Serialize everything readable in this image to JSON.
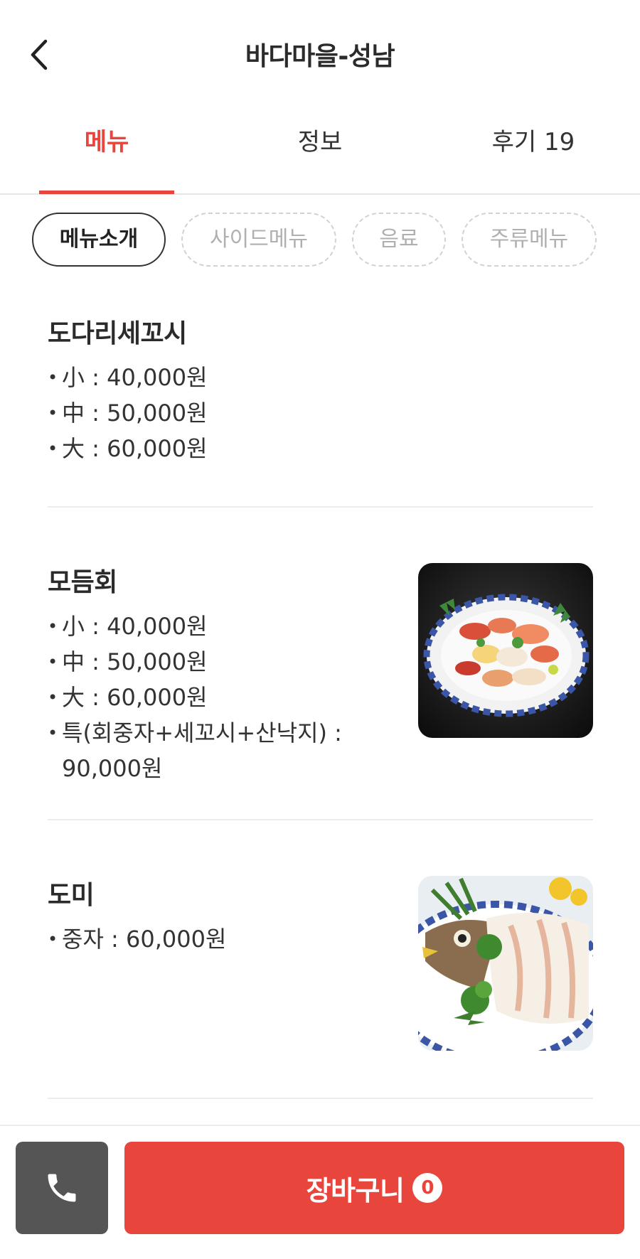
{
  "header": {
    "title": "바다마을-성남",
    "back_icon": "chevron-left-icon"
  },
  "tabs": [
    {
      "label": "메뉴",
      "active": true
    },
    {
      "label": "정보",
      "active": false
    },
    {
      "label": "후기 19",
      "active": false
    }
  ],
  "categories": [
    {
      "label": "메뉴소개",
      "active": true
    },
    {
      "label": "사이드메뉴",
      "active": false
    },
    {
      "label": "음료",
      "active": false
    },
    {
      "label": "주류메뉴",
      "active": false
    }
  ],
  "menu_items": [
    {
      "name": "도다리세꼬시",
      "prices": [
        "小 : 40,000원",
        "中 : 50,000원",
        "大 : 60,000원"
      ],
      "has_image": false
    },
    {
      "name": "모듬회",
      "prices": [
        "小 : 40,000원",
        "中 : 50,000원",
        "大 : 60,000원",
        "특(회중자+세꼬시+산낙지) : 90,000원"
      ],
      "has_image": true
    },
    {
      "name": "도미",
      "prices": [
        "중자 : 60,000원"
      ],
      "has_image": true
    }
  ],
  "bottom_bar": {
    "phone_icon": "phone-icon",
    "cart_label": "장바구니",
    "cart_count": "0"
  },
  "colors": {
    "accent": "#e8453c",
    "phone_button": "#555555",
    "divider": "#ececec",
    "inactive_chip_text": "#b0b0b0"
  }
}
